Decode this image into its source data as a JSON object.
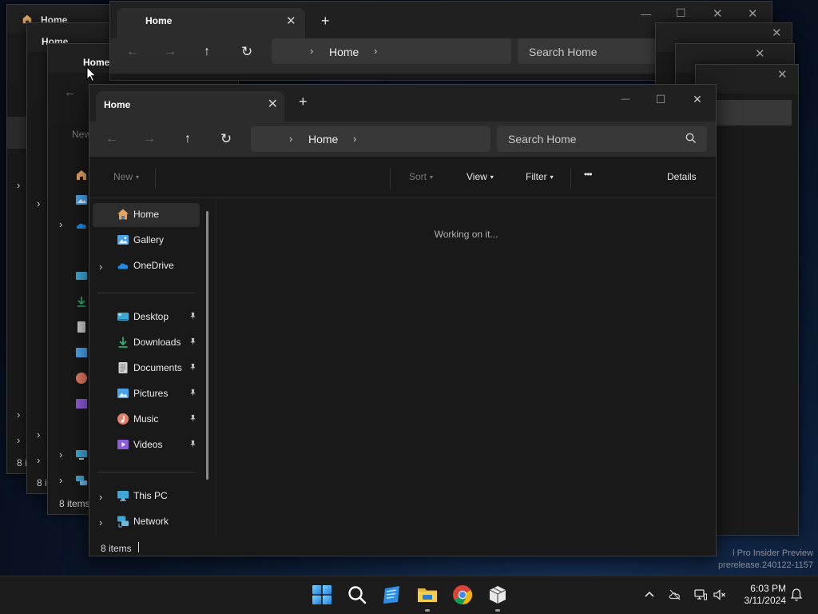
{
  "window": {
    "tab_title": "Home",
    "tab_close": "✕",
    "tab_add": "+",
    "minimize": "—",
    "maximize": "☐",
    "close": "✕"
  },
  "nav": {
    "back": "←",
    "forward": "→",
    "up": "↑",
    "refresh": "↻",
    "address_chevron": "›",
    "address_location": "Home",
    "search_placeholder": "Search Home"
  },
  "commands": {
    "new": "New",
    "sort": "Sort",
    "view": "View",
    "filter": "Filter",
    "more": "•••",
    "details": "Details",
    "caret": "▾"
  },
  "sidebar": {
    "items": [
      {
        "label": "Home",
        "icon": "home-icon",
        "selected": true
      },
      {
        "label": "Gallery",
        "icon": "gallery-icon"
      },
      {
        "label": "OneDrive",
        "icon": "onedrive-icon",
        "expandable": true
      },
      {
        "label": "Desktop",
        "icon": "desktop-icon",
        "pinned": true
      },
      {
        "label": "Downloads",
        "icon": "downloads-icon",
        "pinned": true
      },
      {
        "label": "Documents",
        "icon": "documents-icon",
        "pinned": true
      },
      {
        "label": "Pictures",
        "icon": "pictures-icon",
        "pinned": true
      },
      {
        "label": "Music",
        "icon": "music-icon",
        "pinned": true
      },
      {
        "label": "Videos",
        "icon": "videos-icon",
        "pinned": true
      },
      {
        "label": "This PC",
        "icon": "this-pc-icon",
        "expandable": true
      },
      {
        "label": "Network",
        "icon": "network-icon",
        "expandable": true
      }
    ],
    "chevron": "›"
  },
  "content": {
    "loading_text": "Working on it..."
  },
  "status": {
    "item_count": "8 items"
  },
  "ghost": {
    "tab_title": "Home",
    "close": "✕",
    "item_count": "8 items",
    "item_count_short": "8 ite",
    "item_count_tiny": "8 i",
    "search_placeholder": "Search Home",
    "new": "New",
    "chevron": "›",
    "back": "←",
    "forward": "→",
    "up": "↑",
    "refresh": "↻",
    "more": "•••",
    "minimize": "—",
    "maximize": "☐",
    "add": "+"
  },
  "watermark": {
    "line1": "l Pro Insider Preview",
    "line2": "prerelease.240122-1157"
  },
  "taskbar": {
    "time": "6:03 PM",
    "date": "3/11/2024"
  }
}
